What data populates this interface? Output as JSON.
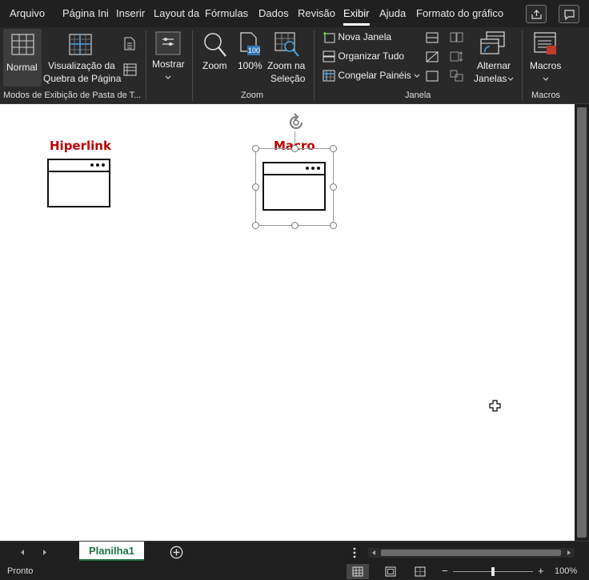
{
  "menu": {
    "tabs": [
      "Arquivo",
      "Página Ini",
      "Inserir",
      "Layout da",
      "Fórmulas",
      "Dados",
      "Revisão",
      "Exibir",
      "Ajuda",
      "Formato do gráfico"
    ],
    "active_tab": "Exibir"
  },
  "ribbon": {
    "workbook_views": {
      "normal": "Normal",
      "page_break_line1": "Visualização da",
      "page_break_line2": "Quebra de Página",
      "group_label": "Modos de Exibição de Pasta de T..."
    },
    "show": {
      "label": "Mostrar"
    },
    "zoom": {
      "zoom": "Zoom",
      "hundred": "100%",
      "hundred_icon_text": "100",
      "zoom_sel_line1": "Zoom na",
      "zoom_sel_line2": "Seleção",
      "group_label": "Zoom"
    },
    "window": {
      "new_window": "Nova Janela",
      "arrange_all": "Organizar Tudo",
      "freeze_panes": "Congelar Painéis",
      "switch_line1": "Alternar",
      "switch_line2": "Janelas",
      "group_label": "Janela"
    },
    "macros": {
      "label": "Macros",
      "group_label": "Macros"
    }
  },
  "sheet": {
    "shapes": [
      {
        "label": "Hiperlink"
      },
      {
        "label": "Macro"
      }
    ]
  },
  "sheet_tabs": {
    "active": "Planilha1"
  },
  "status": {
    "text": "Pronto",
    "zoom": "100%"
  },
  "colors": {
    "label_red": "#c00000",
    "sheet_tab_green": "#1e7145"
  }
}
